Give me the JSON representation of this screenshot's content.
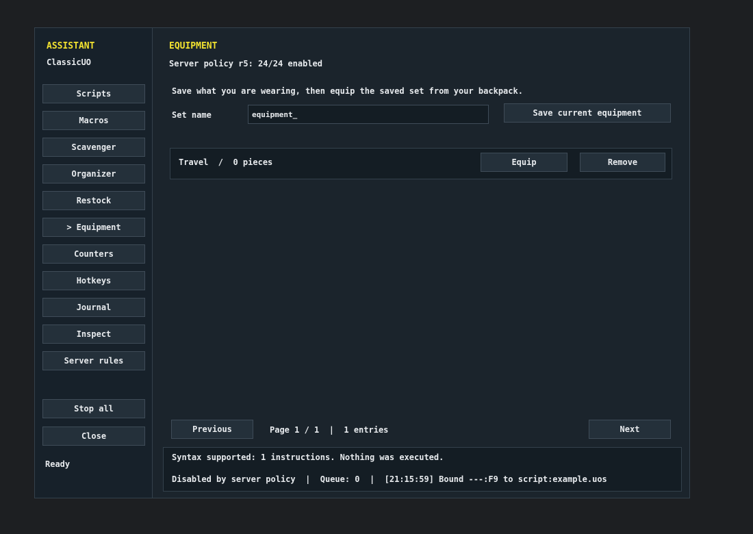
{
  "sidebar": {
    "brand": "ASSISTANT",
    "subtitle": "ClassicUO",
    "items": [
      {
        "label": "Scripts",
        "active": false
      },
      {
        "label": "Macros",
        "active": false
      },
      {
        "label": "Scavenger",
        "active": false
      },
      {
        "label": "Organizer",
        "active": false
      },
      {
        "label": "Restock",
        "active": false
      },
      {
        "label": "Equipment",
        "active": true
      },
      {
        "label": "Counters",
        "active": false
      },
      {
        "label": "Hotkeys",
        "active": false
      },
      {
        "label": "Journal",
        "active": false
      },
      {
        "label": "Inspect",
        "active": false
      },
      {
        "label": "Server rules",
        "active": false
      }
    ],
    "active_marker": ">",
    "stop_all": "Stop all",
    "close": "Close",
    "status": "Ready"
  },
  "main": {
    "title": "EQUIPMENT",
    "policy": "Server policy r5: 24/24 enabled",
    "description": "Save what you are wearing, then equip the saved set from your backpack.",
    "set_name_label": "Set name",
    "set_name_value": "equipment_",
    "save_button": "Save current equipment",
    "sets": [
      {
        "label": "Travel  /  0 pieces",
        "equip": "Equip",
        "remove": "Remove"
      }
    ],
    "pagination": {
      "previous": "Previous",
      "info": "Page 1 / 1  |  1 entries",
      "next": "Next"
    }
  },
  "console": {
    "line1": "Syntax supported: 1 instructions. Nothing was executed.",
    "line2": "Disabled by server policy  |  Queue: 0  |  [21:15:59] Bound ---:F9 to script:example.uos"
  },
  "colors": {
    "accent": "#f2e230",
    "panel": "#1b242c",
    "sidebar": "#17212a",
    "button": "#24303a",
    "border": "#3f4c58"
  }
}
